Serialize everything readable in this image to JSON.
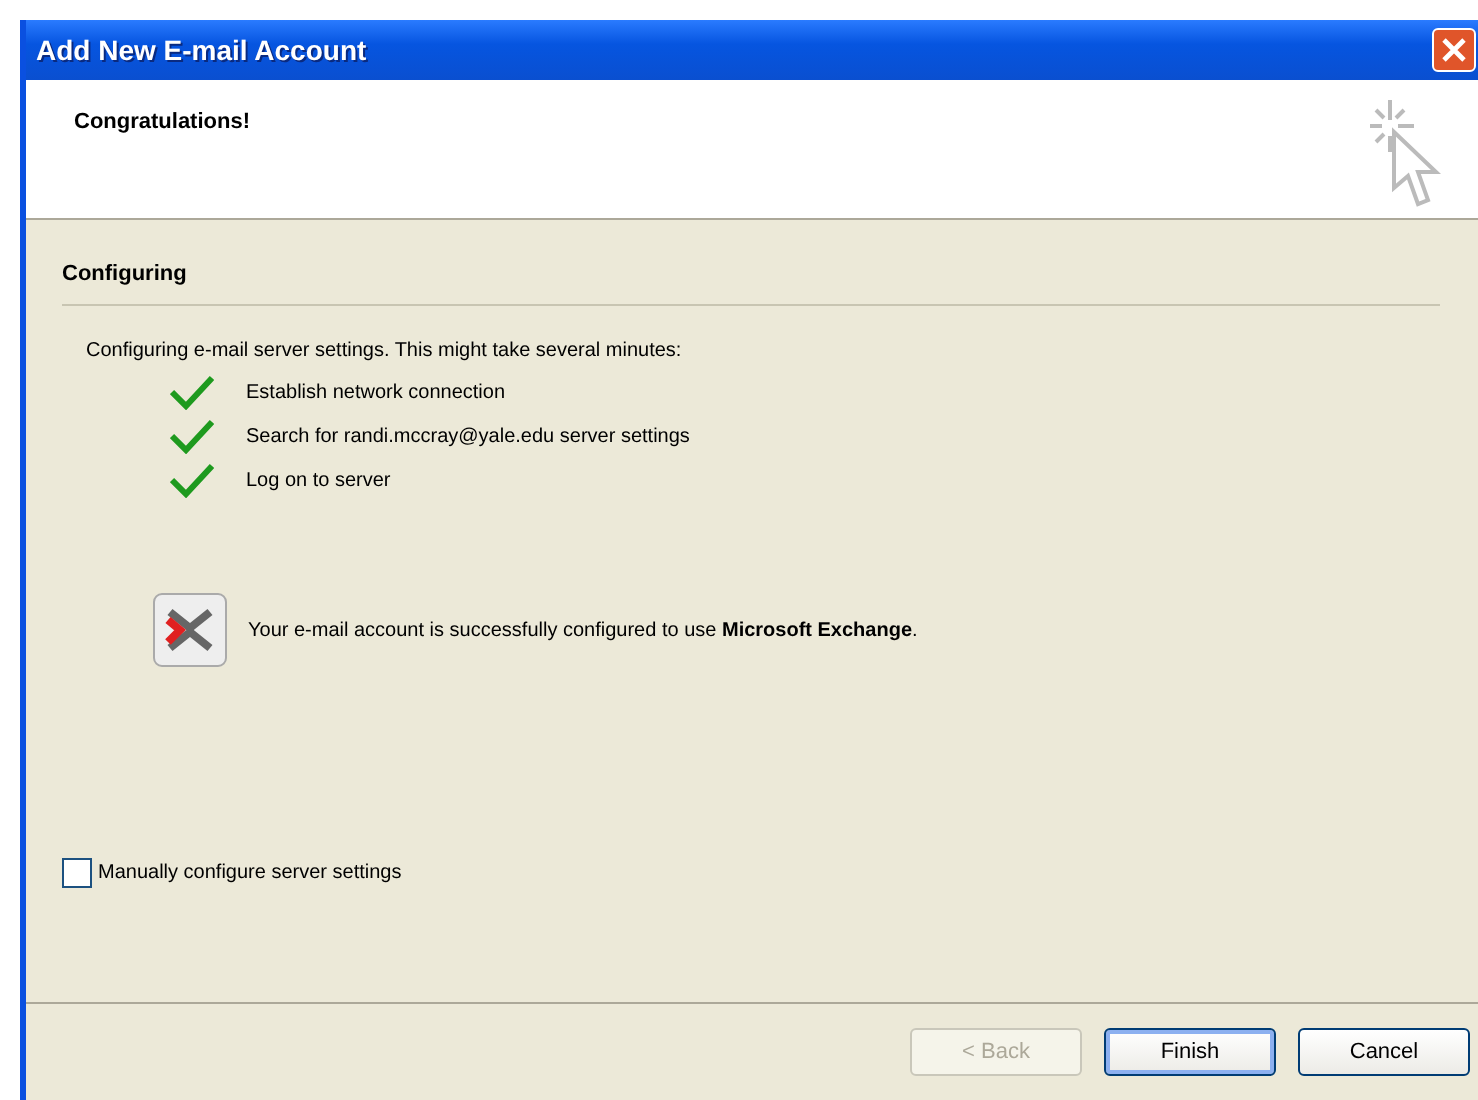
{
  "window": {
    "title": "Add New E-mail Account"
  },
  "header": {
    "title": "Congratulations!"
  },
  "section": {
    "title": "Configuring"
  },
  "intro": "Configuring e-mail server settings. This might take several minutes:",
  "steps": [
    {
      "label": "Establish network connection",
      "done": true
    },
    {
      "label": "Search for randi.mccray@yale.edu server settings",
      "done": true
    },
    {
      "label": "Log on to server",
      "done": true
    }
  ],
  "result": "Your e-mail account is successfully configured to use **Microsoft Exchange**.",
  "manual_config": {
    "label": "Manually configure server settings",
    "checked": false
  },
  "buttons": [
    {
      "label": "< Back",
      "disabled": true,
      "default": false
    },
    {
      "label": "Finish",
      "disabled": false,
      "default": true
    },
    {
      "label": "Cancel",
      "disabled": false,
      "default": false
    }
  ]
}
